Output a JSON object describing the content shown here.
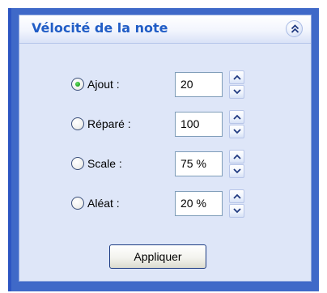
{
  "panel": {
    "title": "Vélocité de la note",
    "collapse_icon": "double-chevron-up-icon"
  },
  "options": [
    {
      "label": "Ajout :",
      "value": "20",
      "selected": true
    },
    {
      "label": "Réparé :",
      "value": "100",
      "selected": false
    },
    {
      "label": "Scale :",
      "value": "75 %",
      "selected": false
    },
    {
      "label": "Aléat :",
      "value": "20 %",
      "selected": false
    }
  ],
  "apply_label": "Appliquer",
  "colors": {
    "frame": "#3f69c8",
    "panel_bg": "#dee6f8",
    "title": "#215dc6",
    "radio_selected": "#21a121"
  }
}
